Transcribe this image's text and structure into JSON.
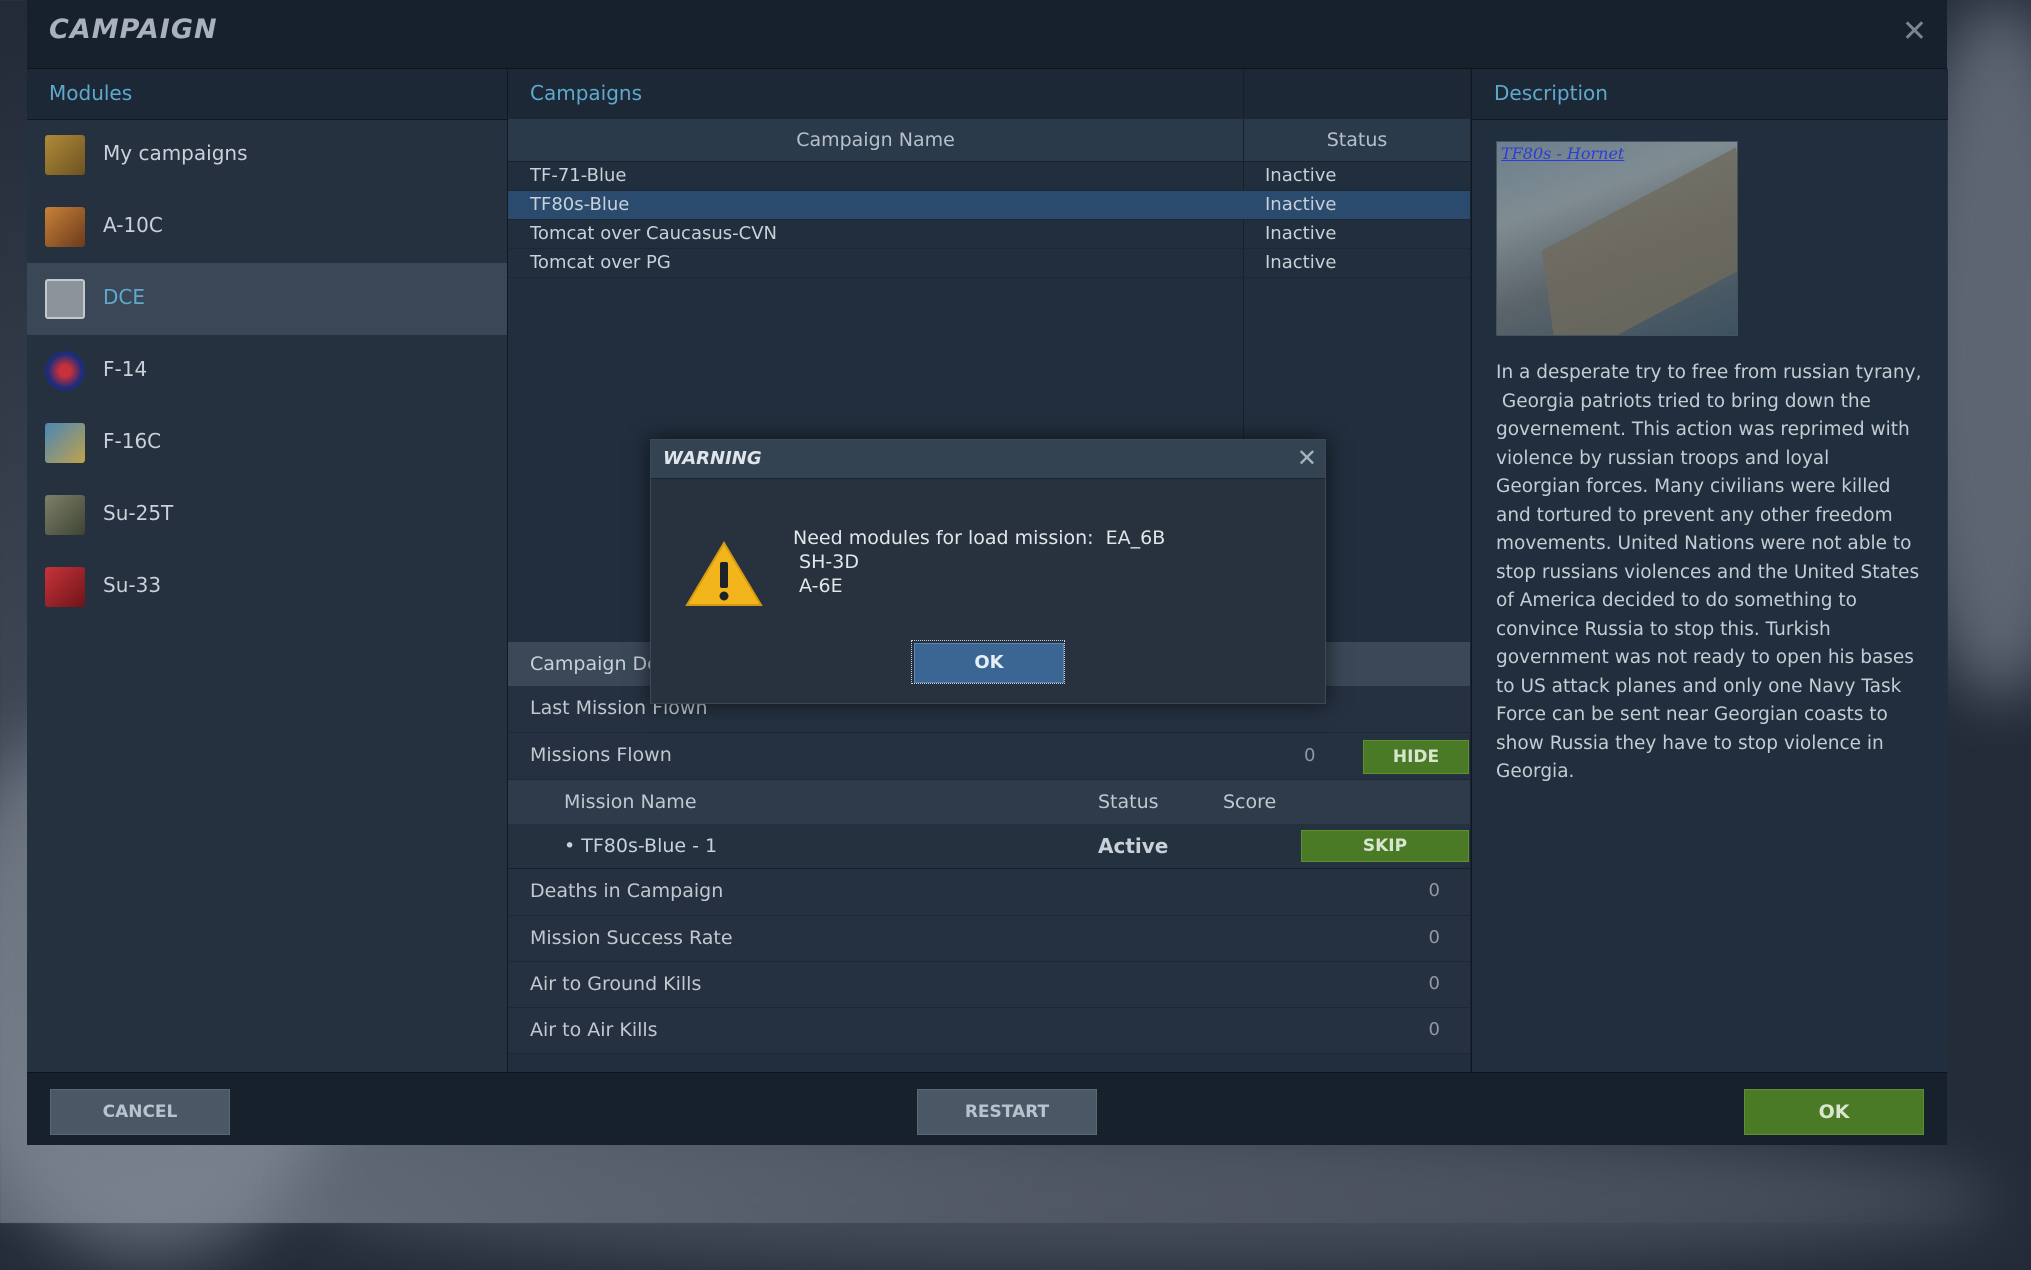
{
  "window": {
    "title": "CAMPAIGN"
  },
  "modules": {
    "header": "Modules",
    "items": [
      {
        "label": "My campaigns",
        "icon": "folder-campaign-icon",
        "selected": false
      },
      {
        "label": "A-10C",
        "icon": "a10c-module-icon",
        "selected": false
      },
      {
        "label": "DCE",
        "icon": "dce-module-icon",
        "selected": true
      },
      {
        "label": "F-14",
        "icon": "f14-module-icon",
        "selected": false
      },
      {
        "label": "F-16C",
        "icon": "f16c-module-icon",
        "selected": false
      },
      {
        "label": "Su-25T",
        "icon": "su25t-module-icon",
        "selected": false
      },
      {
        "label": "Su-33",
        "icon": "su33-module-icon",
        "selected": false
      }
    ]
  },
  "campaigns": {
    "header": "Campaigns",
    "columns": {
      "name": "Campaign Name",
      "status": "Status"
    },
    "rows": [
      {
        "name": "TF-71-Blue",
        "status": "Inactive"
      },
      {
        "name": "TF80s-Blue",
        "status": "Inactive"
      },
      {
        "name": "Tomcat over Caucasus-CVN",
        "status": "Inactive"
      },
      {
        "name": "Tomcat over PG",
        "status": "Inactive"
      }
    ],
    "selected_index": 1
  },
  "details": {
    "header": "Campaign De",
    "last_mission_flown": {
      "label": "Last Mission Flown",
      "value": ""
    },
    "missions_flown": {
      "label": "Missions Flown",
      "value": "0",
      "hide_label": "HIDE"
    },
    "mission_table": {
      "columns": {
        "name": "Mission Name",
        "status": "Status",
        "score": "Score"
      },
      "rows": [
        {
          "name": "• TF80s-Blue - 1",
          "status": "Active",
          "skip_label": "SKIP"
        }
      ]
    },
    "stats": [
      {
        "label": "Deaths in Campaign",
        "value": "0"
      },
      {
        "label": "Mission Success Rate",
        "value": "0"
      },
      {
        "label": "Air to Ground Kills",
        "value": "0"
      },
      {
        "label": "Air to Air Kills",
        "value": "0"
      }
    ]
  },
  "description": {
    "header": "Description",
    "image_caption": "TF80s - Hornet",
    "text": "In a desperate try to free from russian tyrany,\n Georgia patriots tried to bring down the\ngovernement. This action was reprimed with\nviolence by russian troops and loyal\nGeorgian forces. Many civilians were killed\nand tortured to prevent any other freedom\nmovements. United Nations were not able to\nstop russians violences and the United States\nof America decided to do something to\nconvince Russia to stop this. Turkish\ngovernment was not ready to open his bases\nto US attack planes and only one Navy Task\nForce can be sent near Georgian coasts to\nshow Russia they have to stop violence in\nGeorgia."
  },
  "footer": {
    "cancel": "CANCEL",
    "restart": "RESTART",
    "ok": "OK"
  },
  "modal": {
    "title": "WARNING",
    "message": "Need modules for load mission:  EA_6B\n SH-3D\n A-6E",
    "ok": "OK",
    "icon": "warning-triangle-icon"
  },
  "colors": {
    "accent": "#5fa9cc",
    "selected_row": "#2a4b6e",
    "green_button": "#4a7a26",
    "ok_blue": "#3b6592"
  }
}
